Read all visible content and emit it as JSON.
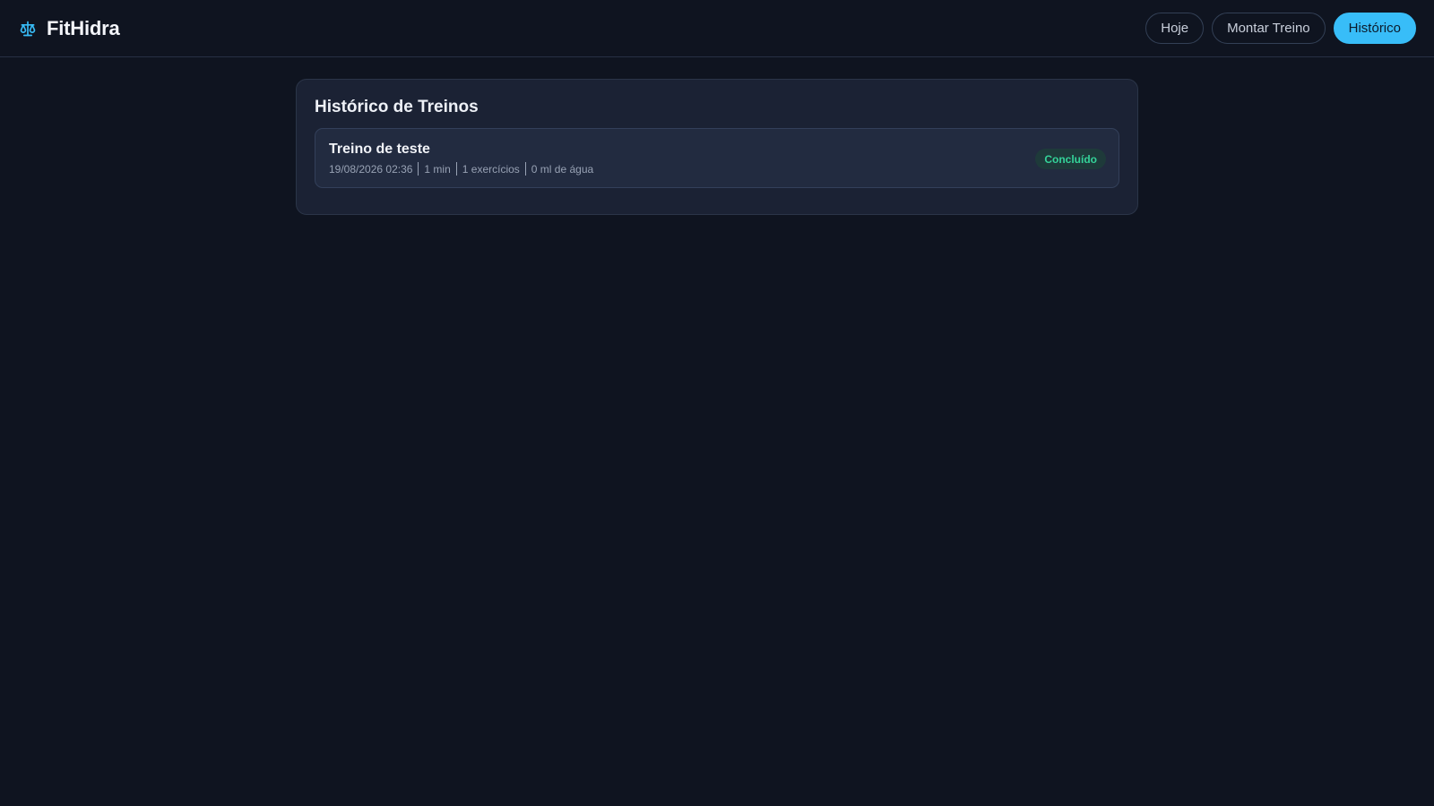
{
  "app": {
    "name": "FitHidra",
    "logo_icon": "scale-icon",
    "accent": "#38bdf8"
  },
  "nav": {
    "items": [
      {
        "label": "Hoje",
        "active": false
      },
      {
        "label": "Montar Treino",
        "active": false
      },
      {
        "label": "Histórico",
        "active": true
      }
    ]
  },
  "history": {
    "title": "Histórico de Treinos",
    "items": [
      {
        "title": "Treino de teste",
        "datetime": "19/08/2026 02:36",
        "duration": "1 min",
        "exercises": "1 exercícios",
        "water": "0 ml de água",
        "status": "Concluído",
        "status_color": "#34d399"
      }
    ]
  }
}
